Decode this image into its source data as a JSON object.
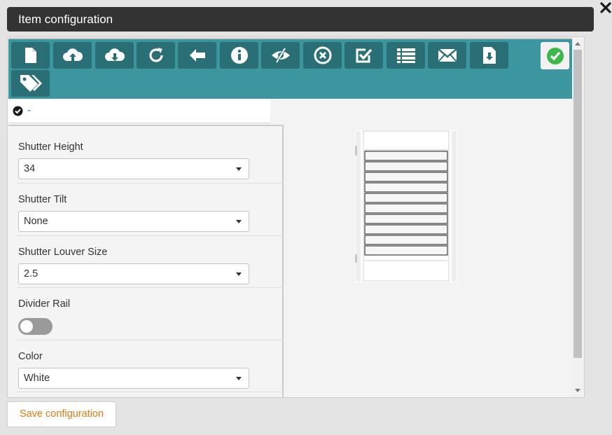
{
  "window": {
    "title": "Item configuration"
  },
  "toolbar": {
    "buttons": [
      {
        "icon": "new-document-icon"
      },
      {
        "icon": "cloud-upload-icon"
      },
      {
        "icon": "cloud-download-icon"
      },
      {
        "icon": "refresh-icon"
      },
      {
        "icon": "back-arrow-icon"
      },
      {
        "icon": "info-icon"
      },
      {
        "icon": "eye-slash-icon"
      },
      {
        "icon": "cancel-circle-icon"
      },
      {
        "icon": "checkbox-checked-icon"
      },
      {
        "icon": "list-icon"
      },
      {
        "icon": "envelope-icon"
      },
      {
        "icon": "file-download-icon"
      },
      {
        "icon": "tags-icon"
      }
    ],
    "ok_icon": "check-circle-icon"
  },
  "status": {
    "text": "-"
  },
  "fields": {
    "shutter_height": {
      "label": "Shutter Height",
      "value": "34"
    },
    "shutter_tilt": {
      "label": "Shutter Tilt",
      "value": "None"
    },
    "shutter_louver_size": {
      "label": "Shutter Louver Size",
      "value": "2.5"
    },
    "divider_rail": {
      "label": "Divider Rail",
      "enabled": false
    },
    "color": {
      "label": "Color",
      "value": "White"
    }
  },
  "footer": {
    "save_label": "Save configuration"
  },
  "colors": {
    "title_bar": "#333333",
    "toolbar": "#3b969f",
    "toolbar_button": "#2a6f76",
    "ok_green": "#3cb84a",
    "save_text": "#e07b12",
    "link_blue": "#1f8fb8"
  }
}
